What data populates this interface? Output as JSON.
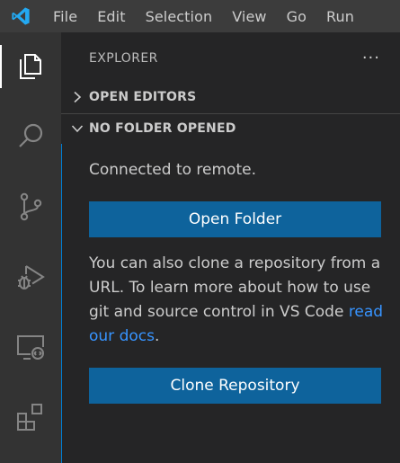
{
  "menu": {
    "items": [
      "File",
      "Edit",
      "Selection",
      "View",
      "Go",
      "Run"
    ]
  },
  "activity_bar": {
    "icons": [
      "explorer-icon",
      "search-icon",
      "source-control-icon",
      "run-debug-icon",
      "remote-explorer-icon",
      "extensions-icon"
    ],
    "active": "explorer-icon"
  },
  "sidebar": {
    "title": "EXPLORER",
    "more_actions": "···",
    "sections": {
      "open_editors": "OPEN EDITORS",
      "no_folder": "NO FOLDER OPENED"
    },
    "panel": {
      "connected_text": "Connected to remote.",
      "open_folder_label": "Open Folder",
      "clone_text_before": "You can also clone a repository from a URL. To learn more about how to use git and source control in VS Code ",
      "clone_link": "read our docs",
      "clone_text_after": ".",
      "clone_button_label": "Clone Repository"
    }
  },
  "colors": {
    "titlebar": "#3c3c3c",
    "activitybar": "#333333",
    "sidebar": "#252526",
    "button": "#0e639c",
    "link": "#3794ff",
    "focus_border": "#007fd4",
    "logo": "#23a9f2"
  }
}
